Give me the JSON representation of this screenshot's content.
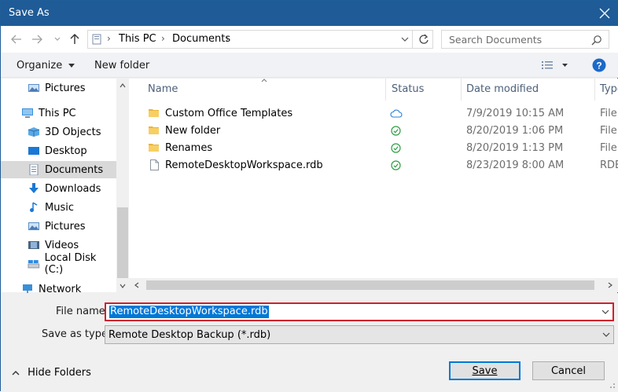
{
  "window": {
    "title": "Save As"
  },
  "address": {
    "crumbs": [
      "This PC",
      "Documents"
    ]
  },
  "search": {
    "placeholder": "Search Documents"
  },
  "toolbar": {
    "organize": "Organize",
    "new_folder": "New folder"
  },
  "nav": {
    "items": [
      {
        "label": "Pictures"
      },
      {
        "label": "This PC"
      },
      {
        "label": "3D Objects"
      },
      {
        "label": "Desktop"
      },
      {
        "label": "Documents"
      },
      {
        "label": "Downloads"
      },
      {
        "label": "Music"
      },
      {
        "label": "Pictures"
      },
      {
        "label": "Videos"
      },
      {
        "label": "Local Disk (C:)"
      },
      {
        "label": "Network"
      }
    ]
  },
  "files": {
    "columns": [
      "Name",
      "Status",
      "Date modified",
      "Type"
    ],
    "rows": [
      {
        "name": "Custom Office Templates",
        "date": "7/9/2019 10:15 AM",
        "type": "File"
      },
      {
        "name": "New folder",
        "date": "8/20/2019 1:06 PM",
        "type": "File"
      },
      {
        "name": "Renames",
        "date": "8/20/2019 1:13 PM",
        "type": "File"
      },
      {
        "name": "RemoteDesktopWorkspace.rdb",
        "date": "8/23/2019 8:00 AM",
        "type": "RDB"
      }
    ]
  },
  "form": {
    "file_name_label": "File name:",
    "file_name_value": "RemoteDesktopWorkspace.rdb",
    "save_type_label": "Save as type:",
    "save_type_value": "Remote Desktop Backup (*.rdb)"
  },
  "actions": {
    "hide_folders": "Hide Folders",
    "save": "Save",
    "cancel": "Cancel"
  },
  "colors": {
    "title_bar": "#1e5b97",
    "highlight": "#d0202d",
    "selection": "#0078d7",
    "status_ok": "#2e9e44",
    "status_cloud": "#2a7fd4"
  }
}
